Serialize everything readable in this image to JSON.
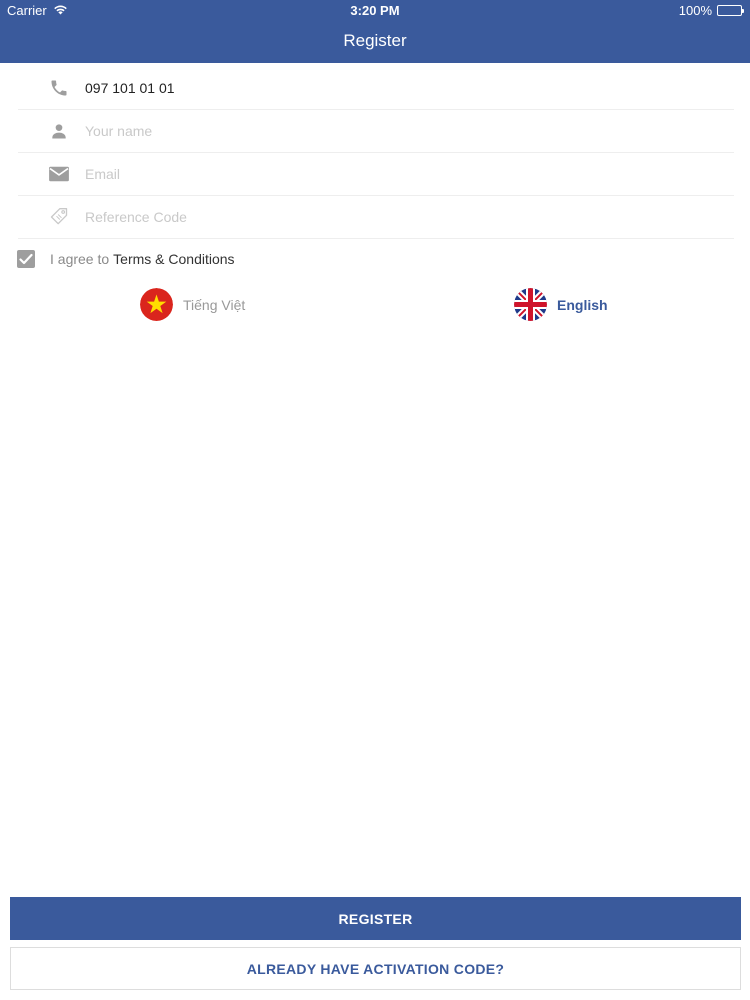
{
  "status_bar": {
    "carrier": "Carrier",
    "time": "3:20 PM",
    "battery_text": "100%",
    "battery_level": 1.0
  },
  "nav": {
    "title": "Register"
  },
  "form": {
    "phone": {
      "value": "097 101 01 01",
      "icon": "phone-icon"
    },
    "name": {
      "placeholder": "Your name",
      "icon": "person-icon"
    },
    "email": {
      "placeholder": "Email",
      "icon": "mail-icon"
    },
    "reference_code": {
      "placeholder": "Reference Code",
      "icon": "tag-icon"
    }
  },
  "agree": {
    "checked": true,
    "prefix": "I agree to",
    "terms_label": "Terms & Conditions"
  },
  "languages": {
    "vietnamese": {
      "label": "Tiếng Việt",
      "icon": "vietnam-flag-icon"
    },
    "english": {
      "label": "English",
      "icon": "uk-flag-icon",
      "selected": true
    }
  },
  "buttons": {
    "register": "REGISTER",
    "activation": "ALREADY HAVE ACTIVATION CODE?"
  },
  "colors": {
    "brand": "#3a5a9c",
    "placeholder": "#c9c9c9",
    "icon": "#9e9e9e"
  }
}
